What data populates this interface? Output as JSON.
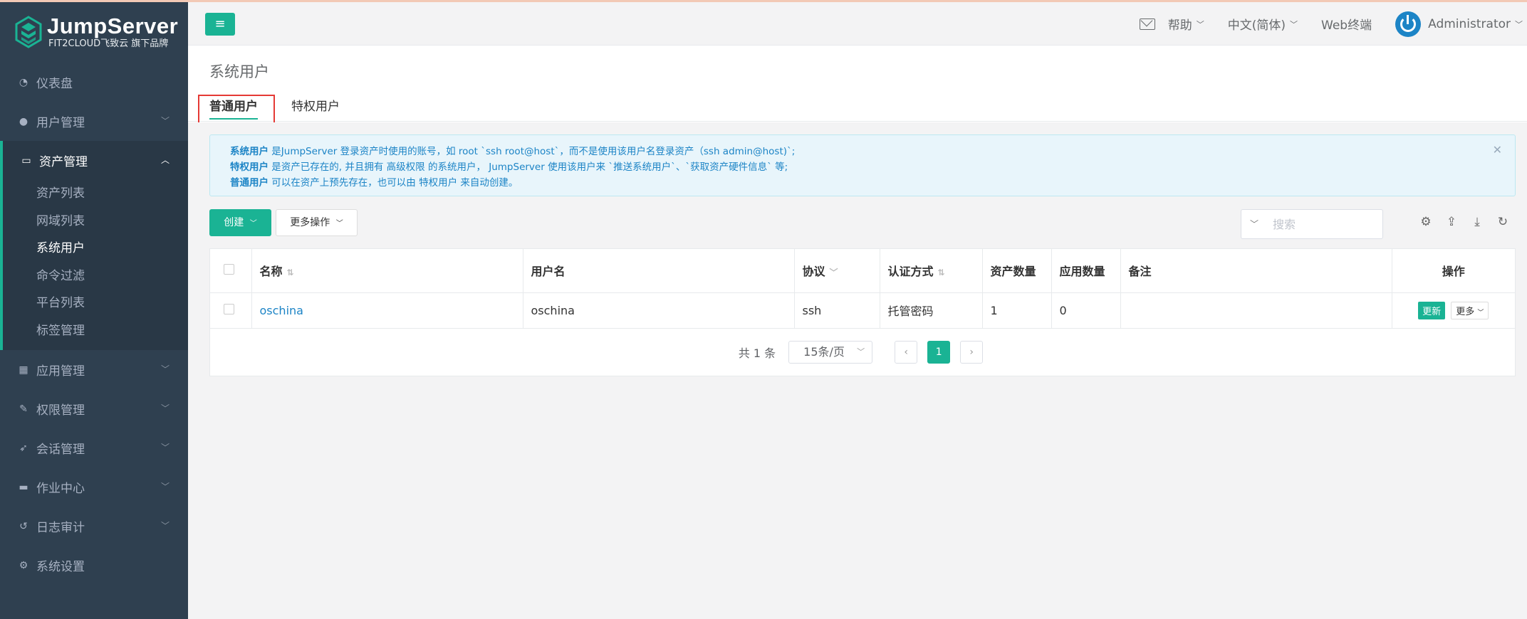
{
  "brand": {
    "title": "JumpServer",
    "subtitle": "FIT2CLOUD飞致云 旗下品牌"
  },
  "sidebar": {
    "items": [
      {
        "label": "仪表盘",
        "icon": "dashboard-icon"
      },
      {
        "label": "用户管理",
        "icon": "users-icon"
      },
      {
        "label": "资产管理",
        "icon": "inbox-icon",
        "active": true
      },
      {
        "label": "应用管理",
        "icon": "grid-icon"
      },
      {
        "label": "权限管理",
        "icon": "edit-icon"
      },
      {
        "label": "会话管理",
        "icon": "rocket-icon"
      },
      {
        "label": "作业中心",
        "icon": "coffee-icon"
      },
      {
        "label": "日志审计",
        "icon": "history-icon"
      },
      {
        "label": "系统设置",
        "icon": "cogs-icon"
      }
    ],
    "asset_subitems": [
      "资产列表",
      "网域列表",
      "系统用户",
      "命令过滤",
      "平台列表",
      "标签管理"
    ]
  },
  "topbar": {
    "help": "帮助",
    "language": "中文(简体)",
    "web_terminal": "Web终端",
    "user": "Administrator"
  },
  "page": {
    "title": "系统用户",
    "tabs": [
      "普通用户",
      "特权用户"
    ]
  },
  "alert": {
    "line1_bold": "系统用户",
    "line1_text": " 是JumpServer 登录资产时使用的账号，如 root `ssh root@host`，而不是使用该用户名登录资产（ssh admin@host)`;",
    "line2_bold": "特权用户",
    "line2_text": " 是资产已存在的, 并且拥有 高级权限 的系统用户， JumpServer 使用该用户来 `推送系统用户`、`获取资产硬件信息` 等;",
    "line3_bold": "普通用户",
    "line3_text": " 可以在资产上预先存在，也可以由 特权用户 来自动创建。"
  },
  "toolbar": {
    "create": "创建",
    "more_actions": "更多操作",
    "search_placeholder": "搜索"
  },
  "table": {
    "headers": [
      "名称",
      "用户名",
      "协议",
      "认证方式",
      "资产数量",
      "应用数量",
      "备注",
      "操作"
    ],
    "rows": [
      {
        "name": "oschina",
        "username": "oschina",
        "protocol": "ssh",
        "auth": "托管密码",
        "assets": "1",
        "apps": "0",
        "comment": "",
        "update": "更新",
        "more": "更多"
      }
    ]
  },
  "pagination": {
    "total": "共 1 条",
    "page_size": "15条/页",
    "current_page": "1"
  },
  "colors": {
    "accent": "#1ab394",
    "sidebar_bg": "#2f4050",
    "link": "#1c84c6",
    "highlight_box": "#e53935"
  }
}
